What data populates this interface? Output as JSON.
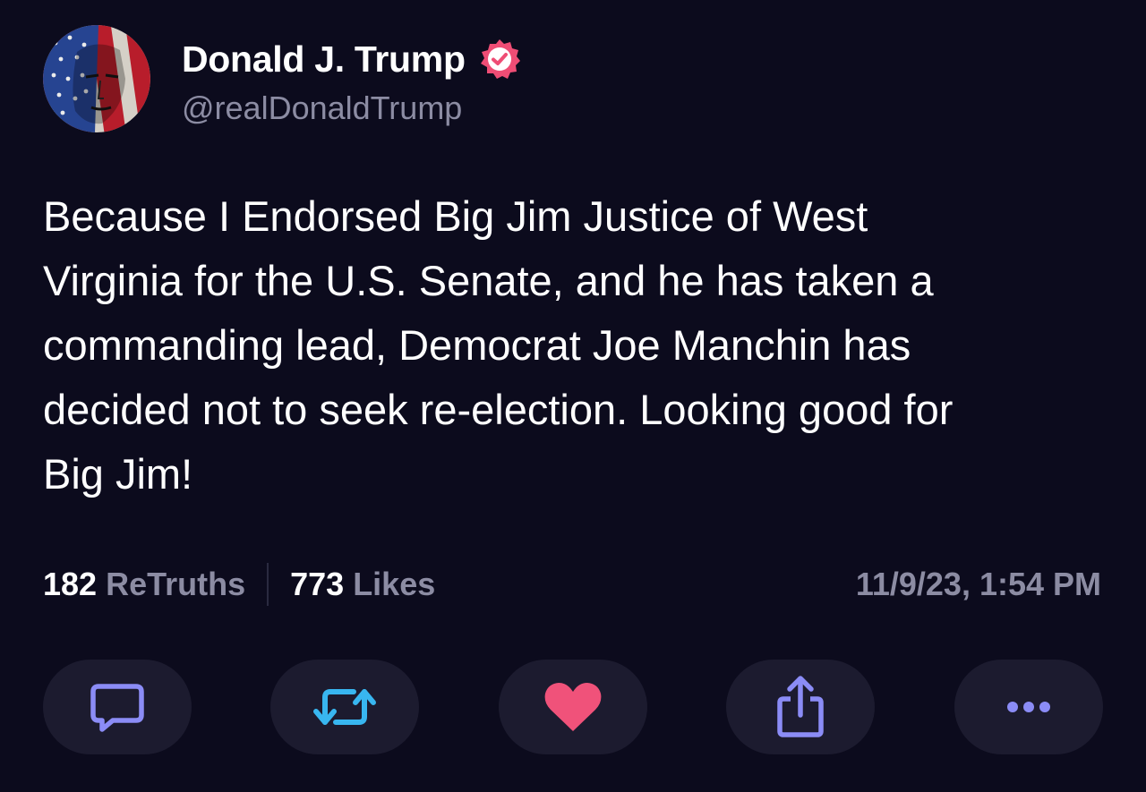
{
  "author": {
    "display_name": "Donald J. Trump",
    "handle": "@realDonaldTrump",
    "verified": true,
    "verified_color": "#ef4d75"
  },
  "post": {
    "lines": [
      "Because I Endorsed Big Jim Justice of West",
      "Virginia for the U.S. Senate, and he has taken a",
      "commanding lead, Democrat Joe Manchin has",
      "decided not to seek re-election. Looking good for",
      "Big Jim!"
    ]
  },
  "stats": {
    "retruths_count": "182",
    "retruths_label": "ReTruths",
    "likes_count": "773",
    "likes_label": "Likes"
  },
  "timestamp": "11/9/23, 1:54 PM",
  "actions": [
    {
      "name": "reply",
      "icon": "speech-bubble-icon",
      "color": "#8b8cf6"
    },
    {
      "name": "retruth",
      "icon": "repost-arrows-icon",
      "color": "#38b6f0"
    },
    {
      "name": "like",
      "icon": "heart-icon",
      "color": "#f0527a"
    },
    {
      "name": "share",
      "icon": "share-icon",
      "color": "#8b8cf6"
    },
    {
      "name": "more",
      "icon": "more-dots-icon",
      "color": "#8b8cf6"
    }
  ],
  "colors": {
    "background": "#0c0b1d",
    "muted_text": "#8c8ca3",
    "button_bg": "#1c1b2f"
  }
}
